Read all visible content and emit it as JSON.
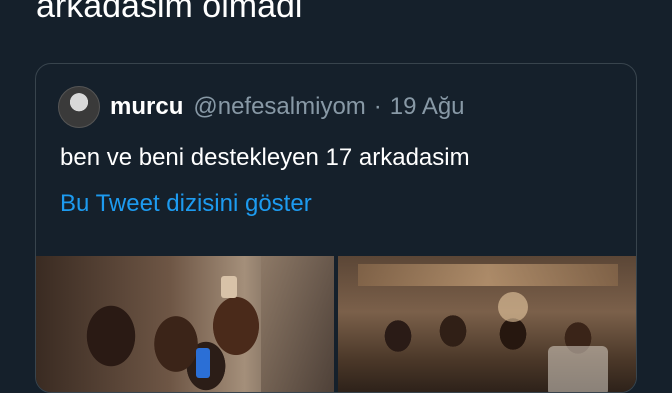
{
  "tweet": {
    "text_fragment": "arkadasim olmadi"
  },
  "quoted_tweet": {
    "display_name": "murcu",
    "handle": "@nefesalmiyom",
    "separator": "·",
    "date": "19 Ağu",
    "text": "ben ve beni destekleyen 17 arkadasim",
    "thread_link": "Bu Tweet dizisini göster",
    "link_color": "#1d9bf0"
  },
  "colors": {
    "background": "#15202b",
    "border": "#38444d",
    "secondary_text": "#8899a6"
  }
}
